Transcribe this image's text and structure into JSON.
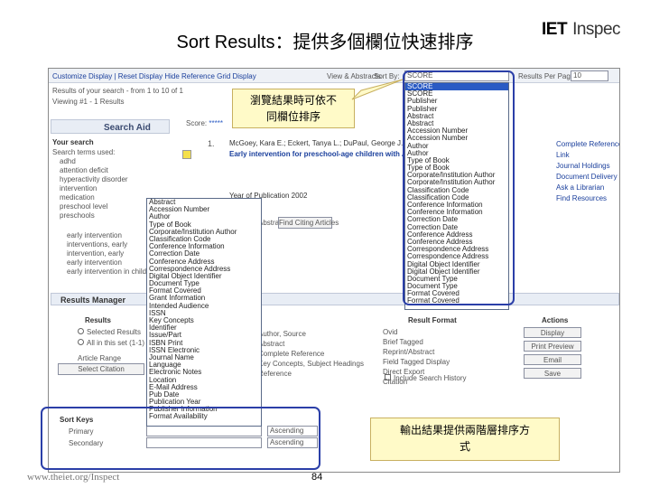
{
  "slide": {
    "title": "Sort Results：提供多個欄位快速排序",
    "footer_url": "www.theiet.org/Inspect",
    "page_number": "84"
  },
  "logo": {
    "iet": "IET",
    "inspec": "Inspec"
  },
  "toolbar": {
    "links": "Customize Display | Reset Display   Hide Reference Grid Display",
    "view": "View & Abstracts",
    "sortby": "Sort By:",
    "sort_value": "SCORE",
    "results_per_page": "Results Per Page:",
    "results_value": "10"
  },
  "results_info": {
    "line1": "Results of your search - from 1 to 10 of 1",
    "line2": "Viewing #1 - 1 Results"
  },
  "search_aid": {
    "header": "Search Aid",
    "your_search": "Your search",
    "terms_label": "Search terms used:",
    "terms": [
      "adhd",
      "attention deficit",
      "hyperactivity disorder",
      "intervention",
      "medication",
      "preschool level",
      "preschools"
    ],
    "tree": [
      "early intervention",
      "interventions, early",
      "intervention, early",
      "early intervention",
      "early intervention in childhood"
    ]
  },
  "result": {
    "number": "1.",
    "score_label": "Score:",
    "stars": "*****",
    "authors": "McGoey, Kara E.; Eckert, Tanya L.; DuPaul, George J.",
    "title": "Early intervention for preschool-age children with ADHD: A literature review",
    "source": "Year of Publication 2002",
    "abstract_label": "Abstract",
    "find_button": "Find Citing Articles"
  },
  "right_links": [
    "Complete Reference",
    "Link",
    "Journal Holdings",
    "Document Delivery",
    "Ask a Librarian",
    "Find Resources"
  ],
  "callouts": {
    "top": [
      "瀏覽結果時可依不",
      "同欄位排序"
    ],
    "bottom": [
      "輸出結果提供兩階層排序方",
      "式"
    ]
  },
  "sort_options": [
    "SCORE",
    "SCORE",
    "Publisher",
    "Publisher",
    "Abstract",
    "Abstract",
    "Accession Number",
    "Accession Number",
    "Author",
    "Author",
    "Type of Book",
    "Type of Book",
    "Corporate/Institution Author",
    "Corporate/Institution Author",
    "Classification Code",
    "Classification Code",
    "Conference Information",
    "Conference Information",
    "Correction Date",
    "Correction Date",
    "Conference Address",
    "Conference Address",
    "Correspondence Address",
    "Correspondence Address",
    "Digital Object Identifier",
    "Digital Object Identifier",
    "Document Type",
    "Document Type",
    "Format Covered",
    "Format Covered"
  ],
  "sort_key_options": [
    "Abstract",
    "Accession Number",
    "Author",
    "Type of Book",
    "Corporate/Institution Author",
    "Classification Code",
    "Conference Information",
    "Correction Date",
    "Conference Address",
    "Correspondence Address",
    "Digital Object Identifier",
    "Document Type",
    "Format Covered",
    "Grant Information",
    "Intended Audience",
    "ISSN",
    "Key Concepts",
    "Identifier",
    "Issue/Part",
    "ISBN Print",
    "ISSN Electronic",
    "Journal Name",
    "Language",
    "Electronic Notes",
    "Location",
    "E-Mail Address",
    "Pub Date",
    "Publication Year",
    "Publisher Information",
    "Format Availability"
  ],
  "results_manager": {
    "header": "Results Manager",
    "results_label": "Results",
    "opt_selected": "Selected Results",
    "opt_all": "All in this set (1-1)",
    "range": "Article Range",
    "range_button": "Select Citation",
    "fields": [
      "Author, Source",
      "Abstract",
      "Complete Reference",
      "Key Concepts, Subject Headings",
      "Reference"
    ],
    "format_label": "Result Format",
    "formats": [
      "Ovid",
      "Brief Tagged",
      "Reprint/Abstract",
      "Field Tagged Display",
      "Direct Export",
      "Citation"
    ],
    "include_history": "Include Search History",
    "actions_label": "Actions",
    "actions": [
      "Display",
      "Print Preview",
      "Email",
      "Save"
    ],
    "sort_keys_label": "Sort Keys",
    "primary": "Primary",
    "secondary": "Secondary",
    "asc1": "Ascending",
    "asc2": "Ascending"
  }
}
